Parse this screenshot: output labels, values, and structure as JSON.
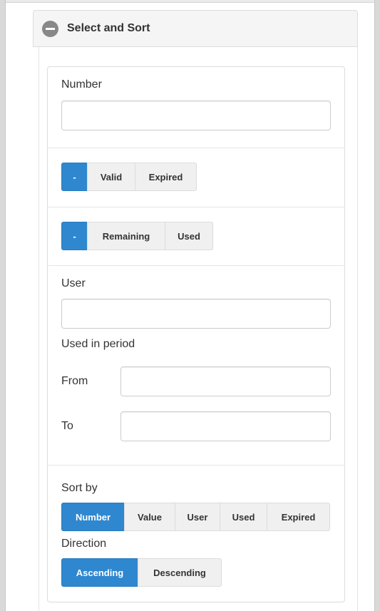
{
  "panel": {
    "title": "Select and Sort"
  },
  "filters": {
    "number_label": "Number",
    "number_value": "",
    "validity": {
      "options": [
        "-",
        "Valid",
        "Expired"
      ],
      "selected": "-"
    },
    "remaining": {
      "options": [
        "-",
        "Remaining",
        "Used"
      ],
      "selected": "-"
    },
    "user_label": "User",
    "user_value": "",
    "used_in_period_label": "Used in period",
    "from_label": "From",
    "from_value": "",
    "to_label": "To",
    "to_value": ""
  },
  "sort": {
    "sort_by_label": "Sort by",
    "sort_by_options": [
      "Number",
      "Value",
      "User",
      "Used",
      "Expired"
    ],
    "sort_by_selected": "Number",
    "direction_label": "Direction",
    "direction_options": [
      "Ascending",
      "Descending"
    ],
    "direction_selected": "Ascending"
  },
  "colors": {
    "active": "#2f87cf",
    "button_bg": "#f0f0f0",
    "header_bg": "#f5f5f5"
  },
  "icons": {
    "collapse": "minus-circle-icon"
  }
}
